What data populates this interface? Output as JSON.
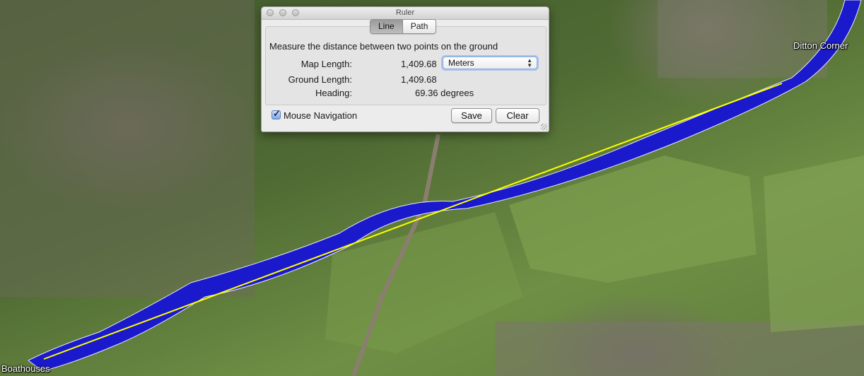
{
  "map": {
    "places": {
      "ditton_corner": "Ditton Corner",
      "boathouses": "Boathouses"
    },
    "colors": {
      "river_highlight": "#1a1acc",
      "measure_line": "#ffff00"
    }
  },
  "ruler": {
    "title": "Ruler",
    "tabs": [
      {
        "label": "Line",
        "active": true
      },
      {
        "label": "Path",
        "active": false
      }
    ],
    "description": "Measure the distance between two points on the ground",
    "map_length": {
      "label": "Map Length:",
      "value": "1,409.68"
    },
    "ground_length": {
      "label": "Ground Length:",
      "value": "1,409.68"
    },
    "heading": {
      "label": "Heading:",
      "value": "69.36 degrees"
    },
    "units": {
      "selected": "Meters"
    },
    "mouse_navigation": {
      "label": "Mouse Navigation",
      "checked": true
    },
    "buttons": {
      "save": "Save",
      "clear": "Clear"
    }
  }
}
